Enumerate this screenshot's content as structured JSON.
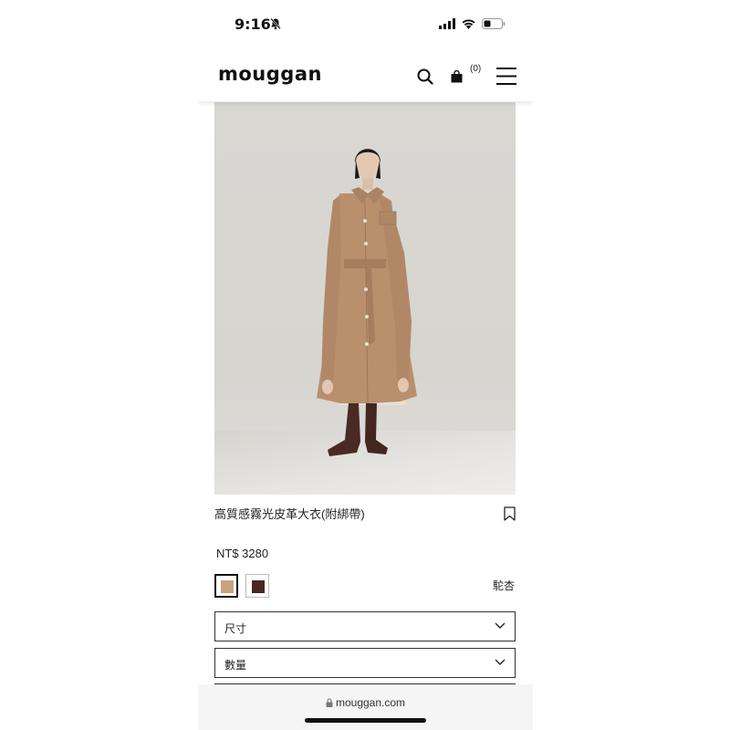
{
  "status_bar": {
    "time": "9:16",
    "icons": [
      "bell-off-icon",
      "signal-icon",
      "wifi-icon",
      "battery-icon"
    ]
  },
  "header": {
    "logo": "mouggan",
    "cart_count": "(0)",
    "icons": [
      "search-icon",
      "shopping-bag-icon",
      "menu-icon"
    ]
  },
  "product": {
    "image_alt": "model wearing camel belted leather coat",
    "title": "高質感霧光皮革大衣(附綁帶)",
    "price": "NT$ 3280",
    "color_selected": "駝杏",
    "swatches": [
      {
        "color": "#c9a27e",
        "selected": true
      },
      {
        "color": "#4a2622",
        "selected": false
      }
    ]
  },
  "options": {
    "size_label": "尺寸",
    "quantity_label": "數量"
  },
  "browser": {
    "url": "mouggan.com"
  },
  "colors": {
    "coat": "#b8906e",
    "boots": "#4a2a24",
    "background": "#d9d7d2"
  }
}
